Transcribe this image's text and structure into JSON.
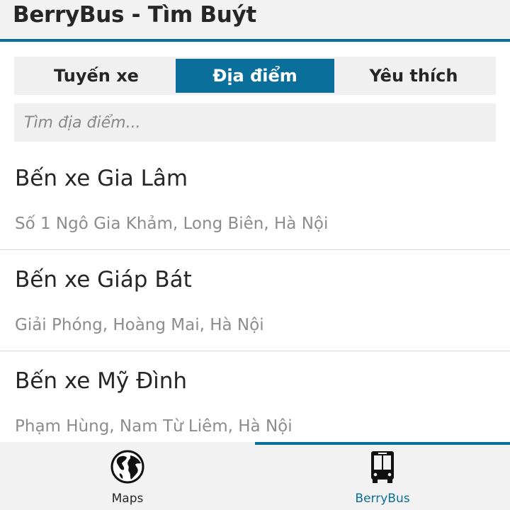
{
  "app": {
    "title": "BerryBus - Tìm Buýt"
  },
  "segments": [
    {
      "label": "Tuyến xe",
      "selected": false
    },
    {
      "label": "Địa điểm",
      "selected": true
    },
    {
      "label": "Yêu thích",
      "selected": false
    }
  ],
  "search": {
    "placeholder": "Tìm địa điểm...",
    "value": ""
  },
  "places": [
    {
      "name": "Bến xe Gia Lâm",
      "address": "Số 1 Ngô Gia Khảm, Long Biên, Hà Nội"
    },
    {
      "name": "Bến xe Giáp Bát",
      "address": "Giải Phóng, Hoàng Mai, Hà Nội"
    },
    {
      "name": "Bến xe Mỹ Đình",
      "address": "Phạm Hùng, Nam Từ Liêm, Hà Nội"
    }
  ],
  "actionbar": {
    "tabs": [
      {
        "label": "Maps",
        "icon": "globe-icon",
        "active": false
      },
      {
        "label": "BerryBus",
        "icon": "bus-icon",
        "active": true
      }
    ]
  },
  "colors": {
    "accent": "#0a6f9a",
    "secondary_text": "#8c8c8c"
  }
}
